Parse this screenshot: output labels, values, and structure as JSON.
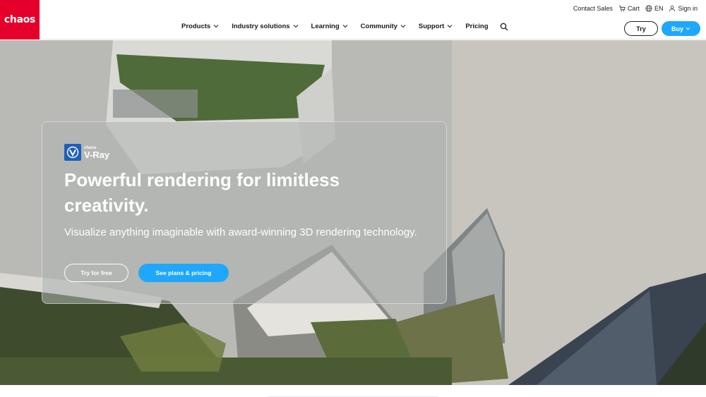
{
  "brand": {
    "logo_text": "chaos",
    "color": "#e4002b"
  },
  "utility": {
    "contact_sales": "Contact Sales",
    "cart": "Cart",
    "language": "EN",
    "sign_in": "Sign in"
  },
  "nav": {
    "items": [
      {
        "label": "Products"
      },
      {
        "label": "Industry solutions"
      },
      {
        "label": "Learning"
      },
      {
        "label": "Community"
      },
      {
        "label": "Support"
      },
      {
        "label": "Pricing"
      }
    ]
  },
  "header_buttons": {
    "try": "Try",
    "buy": "Buy"
  },
  "hero": {
    "product_small": "chaos",
    "product_name": "V-Ray",
    "headline": "Powerful rendering for limitless creativity.",
    "subline": "Visualize anything imaginable with award-winning 3D rendering technology.",
    "cta_primary": "Try for free",
    "cta_secondary": "See plans & pricing"
  },
  "colors": {
    "accent": "#1ea7fd",
    "brand_red": "#e4002b",
    "vray_blue": "#1f5fb8"
  },
  "icons": [
    "cart-icon",
    "globe-icon",
    "user-icon",
    "chevron-down-icon",
    "search-icon",
    "vray-icon"
  ]
}
